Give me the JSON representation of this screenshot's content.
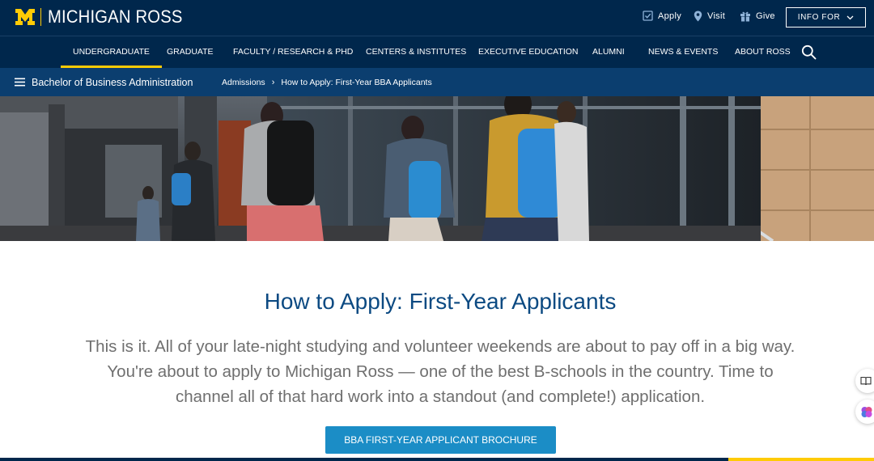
{
  "brand": {
    "name": "MICHIGAN ROSS",
    "colors": {
      "navy": "#00274c",
      "maize": "#ffcb05",
      "subnav": "#0b3e6f",
      "title_blue": "#0c4a82",
      "button_blue": "#1b8dc6"
    }
  },
  "utility_nav": {
    "apply": {
      "label": "Apply",
      "icon": "checkbox-icon"
    },
    "visit": {
      "label": "Visit",
      "icon": "map-pin-icon"
    },
    "give": {
      "label": "Give",
      "icon": "gift-icon"
    },
    "info_for": {
      "label": "INFO FOR",
      "icon": "chevron-down-icon"
    }
  },
  "main_nav": {
    "items": [
      {
        "label": "UNDERGRADUATE",
        "active": true
      },
      {
        "label": "GRADUATE"
      },
      {
        "label": "FACULTY / RESEARCH & PHD"
      },
      {
        "label": "CENTERS & INSTITUTES"
      },
      {
        "label": "EXECUTIVE EDUCATION"
      },
      {
        "label": "ALUMNI"
      },
      {
        "label": "NEWS & EVENTS"
      },
      {
        "label": "ABOUT ROSS"
      }
    ],
    "search_icon": "search-icon"
  },
  "sub_nav": {
    "menu_icon": "hamburger-icon",
    "program": "Bachelor of Business Administration",
    "breadcrumbs": [
      "Admissions",
      "How to Apply: First-Year BBA Applicants"
    ],
    "separator": "›"
  },
  "main": {
    "title": "How to Apply: First-Year Applicants",
    "intro": "This is it. All of your late-night studying and volunteer weekends are about to pay off in a big way. You're about to apply to Michigan Ross — one of the best B-schools in the country. Time to channel all of that hard work into a standout (and complete!) application.",
    "cta_label": "BBA FIRST-YEAR APPLICANT BROCHURE"
  }
}
